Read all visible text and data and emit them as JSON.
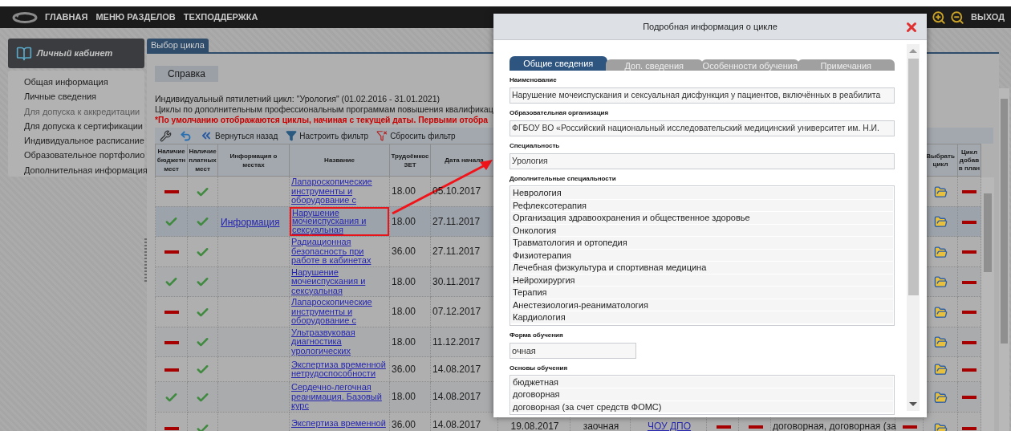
{
  "nav": {
    "items": [
      "ГЛАВНАЯ",
      "МЕНЮ РАЗДЕЛОВ",
      "ТЕХПОДДЕРЖКА"
    ],
    "logout": "ВЫХОД"
  },
  "sidebar": {
    "title": "Личный кабинет",
    "items": [
      {
        "label": "Общая информация",
        "disabled": false
      },
      {
        "label": "Личные сведения",
        "disabled": false
      },
      {
        "label": "Для допуска к аккредитации",
        "disabled": true
      },
      {
        "label": "Для допуска к сертификации",
        "disabled": false
      },
      {
        "label": "Индивидуальное расписание",
        "disabled": false
      },
      {
        "label": "Образовательное портфолио",
        "disabled": false
      },
      {
        "label": "Дополнительная информация",
        "disabled": false
      }
    ]
  },
  "main": {
    "tabs": [
      {
        "label": "Выбор цикла",
        "selected": true
      }
    ],
    "help_button": "Справка",
    "info_lines": [
      "Индивидуальный пятилетний цикл: \"Урология\" (01.02.2016 - 31.01.2021)",
      "Циклы по дополнительным профессиональным программам повышения квалификац"
    ],
    "warning": "*По умолчанию отображаются циклы, начиная с текущей даты. Первыми отобра",
    "toolbar": [
      {
        "kind": "tools"
      },
      {
        "kind": "undo"
      },
      {
        "kind": "back",
        "label": "Вернуться назад"
      },
      {
        "kind": "filter",
        "label": "Настроить фильтр"
      },
      {
        "kind": "reset_filter",
        "label": "Сбросить фильтр"
      }
    ],
    "table": {
      "columns": [
        "Наличие бюджетн мест",
        "Наличие платных мест",
        "Информация о местах",
        "Название",
        "Трудоёмкос ЗЕТ",
        "Дата начала"
      ],
      "right_columns": [
        "Выбрать цикл",
        "Цикл добав в план"
      ],
      "rows": [
        {
          "selected": false,
          "budget_places": false,
          "paid_places": true,
          "name": "Лапароскопические инструменты и оборудование с",
          "hours": "18.00",
          "start": "05.10.2017",
          "in_plan": false
        },
        {
          "selected": true,
          "budget_places": true,
          "paid_places": true,
          "info": "Информация",
          "name": "Нарушение мочеиспускания и сексуальная",
          "hours": "18.00",
          "start": "27.11.2017",
          "in_plan": false
        },
        {
          "selected": false,
          "budget_places": false,
          "paid_places": true,
          "name": "Радиационная безопасность при работе в кабинетах",
          "hours": "36.00",
          "start": "27.11.2017",
          "in_plan": false
        },
        {
          "selected": false,
          "budget_places": true,
          "paid_places": true,
          "name": "Нарушение мочеиспускания и сексуальная",
          "hours": "18.00",
          "start": "30.11.2017",
          "in_plan": false
        },
        {
          "selected": false,
          "budget_places": false,
          "paid_places": true,
          "name": "Лапароскопические инструменты и оборудование с",
          "hours": "18.00",
          "start": "07.12.2017",
          "in_plan": false
        },
        {
          "selected": false,
          "budget_places": false,
          "paid_places": true,
          "name": "Ультразвуковая диагностика урологических",
          "hours": "18.00",
          "start": "11.12.2017",
          "in_plan": false
        },
        {
          "selected": false,
          "budget_places": false,
          "paid_places": true,
          "name": "Экспертиза временной нетрудоспособности",
          "hours": "36.00",
          "start": "14.08.2017",
          "in_plan": false
        },
        {
          "selected": false,
          "budget_places": true,
          "paid_places": true,
          "name": "Сердечно-легочная реанимация. Базовый курс",
          "hours": "18.00",
          "start": "14.08.2017",
          "in_plan": false
        },
        {
          "selected": false,
          "budget_places": false,
          "paid_places": true,
          "name": "Экспертиза временной",
          "hours": "36.00",
          "start": "14.08.2017",
          "column_7": "19.08.2017",
          "column_8": "заочная",
          "column_9": "ЧОУ ДПО",
          "column_10": false,
          "column_11": false,
          "column_12": "договорная, договорная (за",
          "column_13": false,
          "in_plan": false
        }
      ]
    }
  },
  "modal": {
    "title": "Подробная информация о цикле",
    "tabs": [
      {
        "label": "Общие сведения",
        "selected": true
      },
      {
        "label": "Доп. сведения",
        "selected": false
      },
      {
        "label": "Особенности обучения",
        "selected": false
      },
      {
        "label": "Примечания",
        "selected": false
      }
    ],
    "fields": [
      {
        "kind": "text",
        "label": "Наименование",
        "value": "Нарушение мочеиспускания и сексуальная дисфункция у пациентов, включённых в реабилита"
      },
      {
        "kind": "text",
        "label": "Образовательная организация",
        "value": "ФГБОУ ВО «Российский национальный исследовательский медицинский университет им. Н.И."
      },
      {
        "kind": "text",
        "label": "Специальность",
        "value": "Урология"
      },
      {
        "kind": "list",
        "label": "Дополнительные специальности",
        "items": [
          "Неврология",
          "Рефлексотерапия",
          "Организация здравоохранения и общественное здоровье",
          "Онкология",
          "Травматология и ортопедия",
          "Физиотерапия",
          "Лечебная физкультура и спортивная медицина",
          "Нейрохирургия",
          "Терапия",
          "Анестезиология-реаниматология",
          "Кардиология"
        ]
      },
      {
        "kind": "short",
        "label": "Форма обучения",
        "value": "очная"
      },
      {
        "kind": "list",
        "label": "Основы обучения",
        "items": [
          "бюджетная",
          "договорная",
          "договорная (за счет средств ФОМС)"
        ]
      }
    ]
  }
}
